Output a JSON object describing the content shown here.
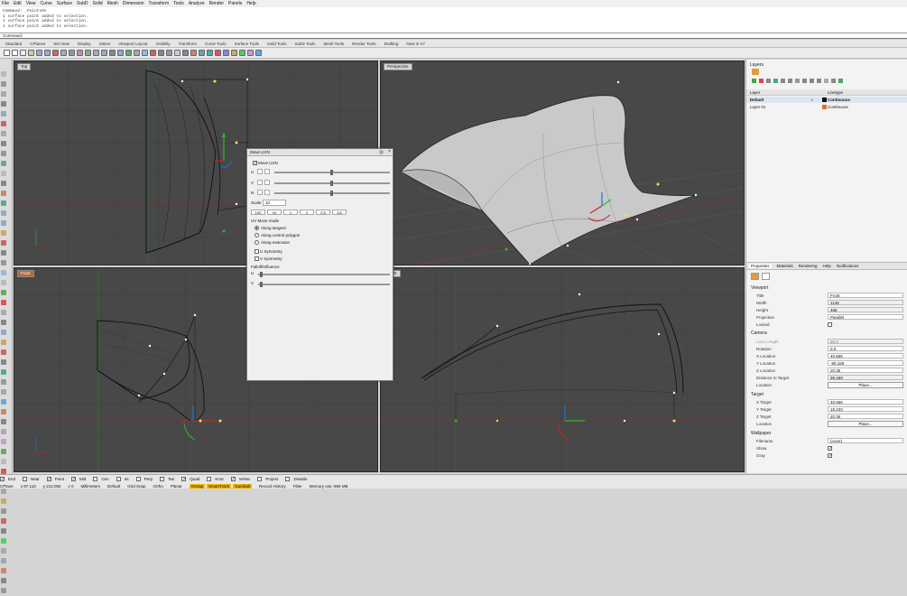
{
  "menu": [
    "File",
    "Edit",
    "View",
    "Curve",
    "Surface",
    "SubD",
    "Solid",
    "Mesh",
    "Dimension",
    "Transform",
    "Tools",
    "Analyze",
    "Render",
    "Panels",
    "Help"
  ],
  "command_history": [
    "Command: _PointsOn",
    "1 surface point added to selection.",
    "1 surface point added to selection.",
    "1 surface point added to selection."
  ],
  "command_prompt": "Command:",
  "toolbar_tabs": [
    "Standard",
    "CPlanes",
    "Set View",
    "Display",
    "Select",
    "Viewport Layout",
    "Visibility",
    "Transform",
    "Curve Tools",
    "Surface Tools",
    "Solid Tools",
    "SubD Tools",
    "Mesh Tools",
    "Render Tools",
    "Drafting",
    "New in V7"
  ],
  "viewports": {
    "top": "Top",
    "perspective": "Perspective",
    "front": "Front",
    "right": "Right"
  },
  "dialog": {
    "title": "Move UVN",
    "move_uvn": "Move UVN",
    "labels": [
      "U",
      "V",
      "N"
    ],
    "scale_label": "Scale",
    "scale_value": "10",
    "multipliers": [
      "100",
      "10",
      "1",
      "2",
      "2.5",
      "1/4"
    ],
    "mode_title": "UV Move mode",
    "modes": [
      "Along tangent",
      "Along control polygon",
      "Along extension"
    ],
    "symmetry": [
      "U Symmetry",
      "V Symmetry"
    ],
    "falloff_label": "Falloff/Influence"
  },
  "layers": {
    "title": "Layers",
    "col_layer": "Layer",
    "col_linetype": "Linetype",
    "rows": [
      {
        "name": "Default",
        "linetype": "Continuous",
        "color": "#111111",
        "bold": true
      },
      {
        "name": "Layer 01",
        "linetype": "Continuous",
        "color": "#e07030",
        "bold": false
      }
    ]
  },
  "panel_tabs": [
    "Properties",
    "Materials",
    "Rendering",
    "Help",
    "Notifications"
  ],
  "viewport_props": {
    "section": "Viewport",
    "rows": [
      [
        "Title",
        "Front"
      ],
      [
        "Width",
        "1148"
      ],
      [
        "Height",
        "468"
      ],
      [
        "Projection",
        "Parallel"
      ],
      [
        "Locked",
        ""
      ]
    ]
  },
  "camera_props": {
    "section": "Camera",
    "rows": [
      [
        "Lens Length",
        "50.0"
      ],
      [
        "Rotation",
        "0.0"
      ],
      [
        "X Location",
        "40.555"
      ],
      [
        "Y Location",
        "-80.169"
      ],
      [
        "Z Location",
        "20.35"
      ],
      [
        "Distance to Target",
        "99.469"
      ]
    ],
    "location_label": "Location",
    "place_btn": "Place..."
  },
  "target_props": {
    "section": "Target",
    "rows": [
      [
        "X Target",
        "40.555"
      ],
      [
        "Y Target",
        "19.233"
      ],
      [
        "Z Target",
        "20.35"
      ]
    ],
    "location_label": "Location",
    "place_btn": "Place..."
  },
  "wallpaper_props": {
    "section": "Wallpaper",
    "filename_label": "Filename",
    "filename_value": "(none)",
    "show_label": "Show",
    "gray_label": "Gray"
  },
  "osnaps": [
    {
      "label": "End",
      "on": true
    },
    {
      "label": "Near",
      "on": false
    },
    {
      "label": "Point",
      "on": true
    },
    {
      "label": "Mid",
      "on": true
    },
    {
      "label": "Cen",
      "on": false
    },
    {
      "label": "Int",
      "on": false
    },
    {
      "label": "Perp",
      "on": false
    },
    {
      "label": "Tan",
      "on": false
    },
    {
      "label": "Quad",
      "on": true
    },
    {
      "label": "Knot",
      "on": false
    },
    {
      "label": "Vertex",
      "on": true
    },
    {
      "label": "Project",
      "on": false
    },
    {
      "label": "Disable",
      "on": false
    }
  ],
  "status": {
    "cplane": "CPlane",
    "x": "x 87.110",
    "y": "y 212.092",
    "z": "z 0",
    "units": "Millimeters",
    "layer": "Default",
    "grid_snap": "Grid Snap",
    "ortho": "Ortho",
    "planar": "Planar",
    "osnap": "Osnap",
    "smarttrack": "SmartTrack",
    "gumball": "Gumball",
    "record_history": "Record History",
    "filter": "Filter",
    "memory": "Memory use: 559 MB"
  }
}
